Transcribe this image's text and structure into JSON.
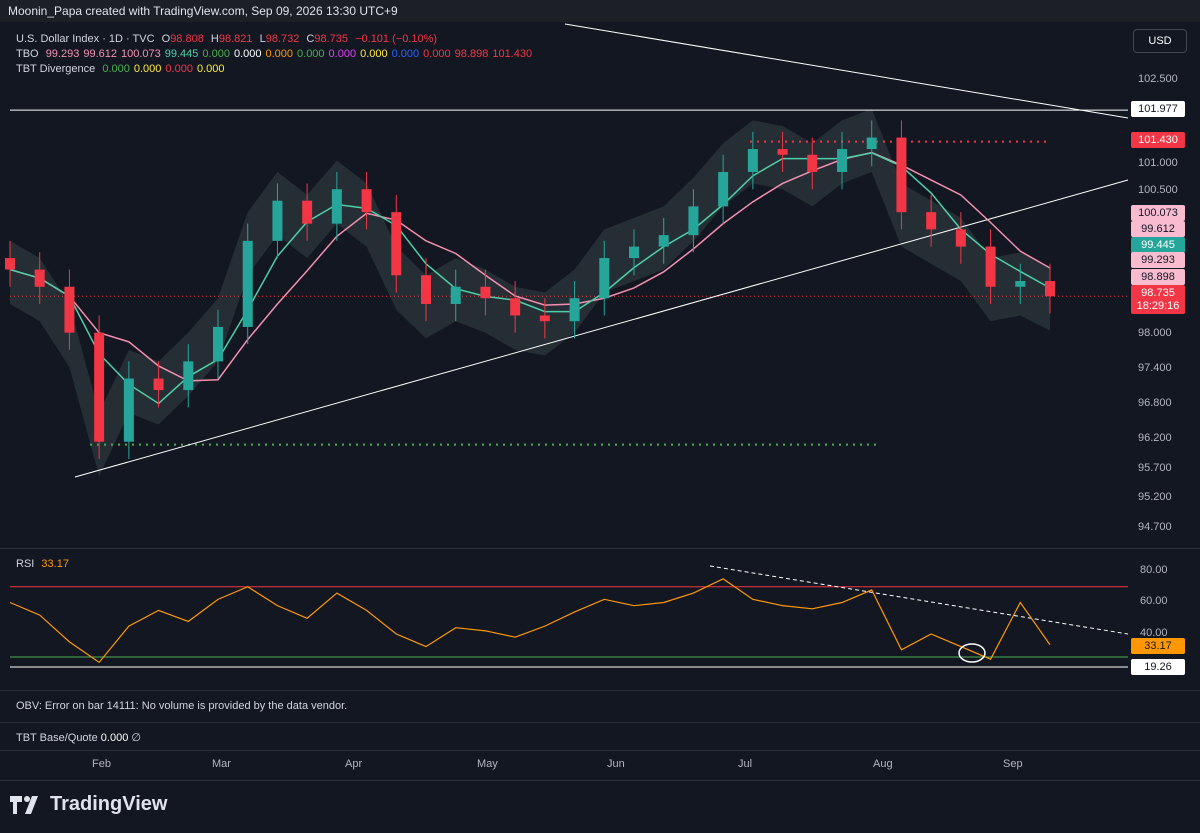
{
  "header": {
    "text": "Moonin_Papa created with TradingView.com, Sep 09, 2026 13:30 UTC+9"
  },
  "symbol": {
    "name": "U.S. Dollar Index · 1D · TVC",
    "o_label": "O",
    "o": "98.808",
    "h_label": "H",
    "h": "98.821",
    "l_label": "L",
    "l": "98.732",
    "c_label": "C",
    "c": "98.735",
    "change": "−0.101 (−0.10%)"
  },
  "tbo": {
    "name": "TBO",
    "values": [
      {
        "v": "99.293",
        "color": "#f48fb1"
      },
      {
        "v": "99.612",
        "color": "#f48fb1"
      },
      {
        "v": "100.073",
        "color": "#f48fb1"
      },
      {
        "v": "99.445",
        "color": "#4dd0a8"
      },
      {
        "v": "0.000",
        "color": "#4caf50"
      },
      {
        "v": "0.000",
        "color": "#ffffff"
      },
      {
        "v": "0.000",
        "color": "#ff9800"
      },
      {
        "v": "0.000",
        "color": "#4caf50"
      },
      {
        "v": "0.000",
        "color": "#e040fb"
      },
      {
        "v": "0.000",
        "color": "#ffeb3b"
      },
      {
        "v": "0.000",
        "color": "#2962ff"
      },
      {
        "v": "0.000",
        "color": "#f23645"
      },
      {
        "v": "98.898",
        "color": "#f23645"
      },
      {
        "v": "101.430",
        "color": "#f23645"
      }
    ]
  },
  "divergence": {
    "name": "TBT Divergence",
    "values": [
      {
        "v": "0.000",
        "color": "#4caf50"
      },
      {
        "v": "0.000",
        "color": "#ffeb3b"
      },
      {
        "v": "0.000",
        "color": "#f23645"
      },
      {
        "v": "0.000",
        "color": "#ffeb3b"
      }
    ]
  },
  "currency_button": "USD",
  "price_axis": [
    "102.500",
    "101.000",
    "100.500",
    "98.000",
    "97.400",
    "96.800",
    "96.200",
    "95.700",
    "95.200",
    "94.700"
  ],
  "price_tags": [
    {
      "label": "101.977",
      "bg": "#ffffff",
      "fg": "#131722"
    },
    {
      "label": "101.430",
      "bg": "#f23645",
      "fg": "#ffffff"
    },
    {
      "label": "100.073",
      "bg": "#f8bbd0",
      "fg": "#131722"
    },
    {
      "label": "99.612",
      "bg": "#f8bbd0",
      "fg": "#131722"
    },
    {
      "label": "99.445",
      "bg": "#26a69a",
      "fg": "#ffffff"
    },
    {
      "label": "99.293",
      "bg": "#f8bbd0",
      "fg": "#131722"
    },
    {
      "label": "98.898",
      "bg": "#f8bbd0",
      "fg": "#131722"
    },
    {
      "label": "98.735",
      "bg": "#f23645",
      "fg": "#ffffff"
    },
    {
      "label": "18:29:16",
      "bg": "#f23645",
      "fg": "#ffffff"
    }
  ],
  "rsi": {
    "label": "RSI",
    "value": "33.17",
    "axis": [
      "80.00",
      "60.00",
      "40.00"
    ],
    "tags": [
      {
        "label": "33.17",
        "bg": "#ff9800",
        "fg": "#131722"
      },
      {
        "label": "19.26",
        "bg": "#ffffff",
        "fg": "#131722"
      }
    ]
  },
  "obv": {
    "text": "OBV: Error on bar 14111: No volume is provided by the data vendor."
  },
  "tbt_base": {
    "text": "TBT Base/Quote",
    "value": "0.000",
    "extra": "∅"
  },
  "months": [
    "Feb",
    "Mar",
    "Apr",
    "May",
    "Jun",
    "Jul",
    "Aug",
    "Sep"
  ],
  "brand": "TradingView",
  "colors": {
    "up": "#26a69a",
    "down": "#f23645",
    "background": "#131722",
    "rsi": "#ff9800",
    "fast_ma": "#4dd0a8",
    "slow_ma": "#f48fb1"
  },
  "chart_data": {
    "type": "candlestick",
    "x": [
      "2026-01-06",
      "2026-01-13",
      "2026-01-20",
      "2026-01-27",
      "2026-02-03",
      "2026-02-10",
      "2026-02-17",
      "2026-02-24",
      "2026-03-03",
      "2026-03-10",
      "2026-03-17",
      "2026-03-24",
      "2026-03-31",
      "2026-04-07",
      "2026-04-14",
      "2026-04-21",
      "2026-04-28",
      "2026-05-05",
      "2026-05-12",
      "2026-05-19",
      "2026-05-26",
      "2026-06-02",
      "2026-06-09",
      "2026-06-16",
      "2026-06-23",
      "2026-06-30",
      "2026-07-07",
      "2026-07-14",
      "2026-07-21",
      "2026-07-28",
      "2026-08-04",
      "2026-08-11",
      "2026-08-18",
      "2026-08-25",
      "2026-09-01",
      "2026-09-08"
    ],
    "close": [
      99.2,
      98.9,
      98.1,
      96.2,
      97.3,
      97.1,
      97.6,
      98.2,
      99.7,
      100.4,
      100.0,
      100.6,
      100.2,
      99.1,
      98.6,
      98.9,
      98.7,
      98.4,
      98.3,
      98.7,
      99.4,
      99.6,
      99.8,
      100.3,
      100.9,
      101.3,
      101.2,
      100.9,
      101.3,
      101.5,
      100.2,
      99.9,
      99.6,
      98.9,
      99.0,
      98.735
    ],
    "rsi": [
      60,
      52,
      35,
      22,
      45,
      55,
      48,
      62,
      70,
      58,
      50,
      66,
      55,
      40,
      32,
      44,
      42,
      38,
      45,
      54,
      62,
      58,
      60,
      66,
      75,
      62,
      58,
      56,
      60,
      68,
      30,
      40,
      32,
      24,
      60,
      33.17
    ],
    "price_lines": {
      "resistance": 101.977,
      "upper": 101.43,
      "lower": 96.15,
      "rsi_upper": 70,
      "rsi_lower": 19.26
    },
    "ylim": [
      94.4,
      103.2
    ]
  }
}
